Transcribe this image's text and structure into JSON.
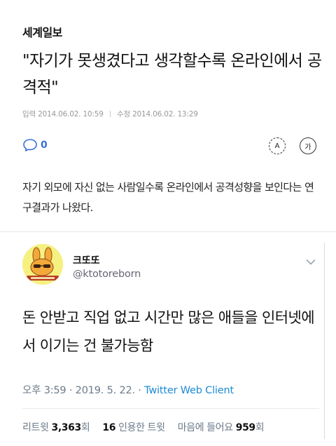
{
  "article": {
    "press": "세계일보",
    "headline": "\"자기가 못생겼다고 생각할수록 온라인에서 공격적\"",
    "input_label": "입력",
    "input_date": "2014.06.02. 10:59",
    "edit_label": "수정",
    "edit_date": "2014.06.02. 13:29",
    "comment_count": "0",
    "font_size_btn": "A",
    "font_btn": "가",
    "summary": "자기 외모에 자신 없는 사람일수록 온라인에서 공격성향을 보인다는 연구결과가 나왔다."
  },
  "tweet": {
    "display_name": "크또또",
    "handle": "@ktotoreborn",
    "text": "돈 안받고 직업 없고 시간만 많은 애들을 인터넷에서 이기는 건 불가능함",
    "time": "오후 3:59 · 2019. 5. 22. · ",
    "client": "Twitter Web Client",
    "retweets_label": "리트윗",
    "retweets": "3,363",
    "retweets_unit": "회",
    "quotes": "16",
    "quotes_label": "인용한 트윗",
    "likes_label": "마음에 들어요",
    "likes": "959",
    "likes_unit": "회"
  },
  "colors": {
    "accent_blue": "#3a6fd8",
    "twitter_blue": "#1d8bd4",
    "avatar_bg": "#f6f080"
  },
  "icons": [
    "comment-icon",
    "font-size-icon",
    "font-icon",
    "chevron-down-icon"
  ]
}
